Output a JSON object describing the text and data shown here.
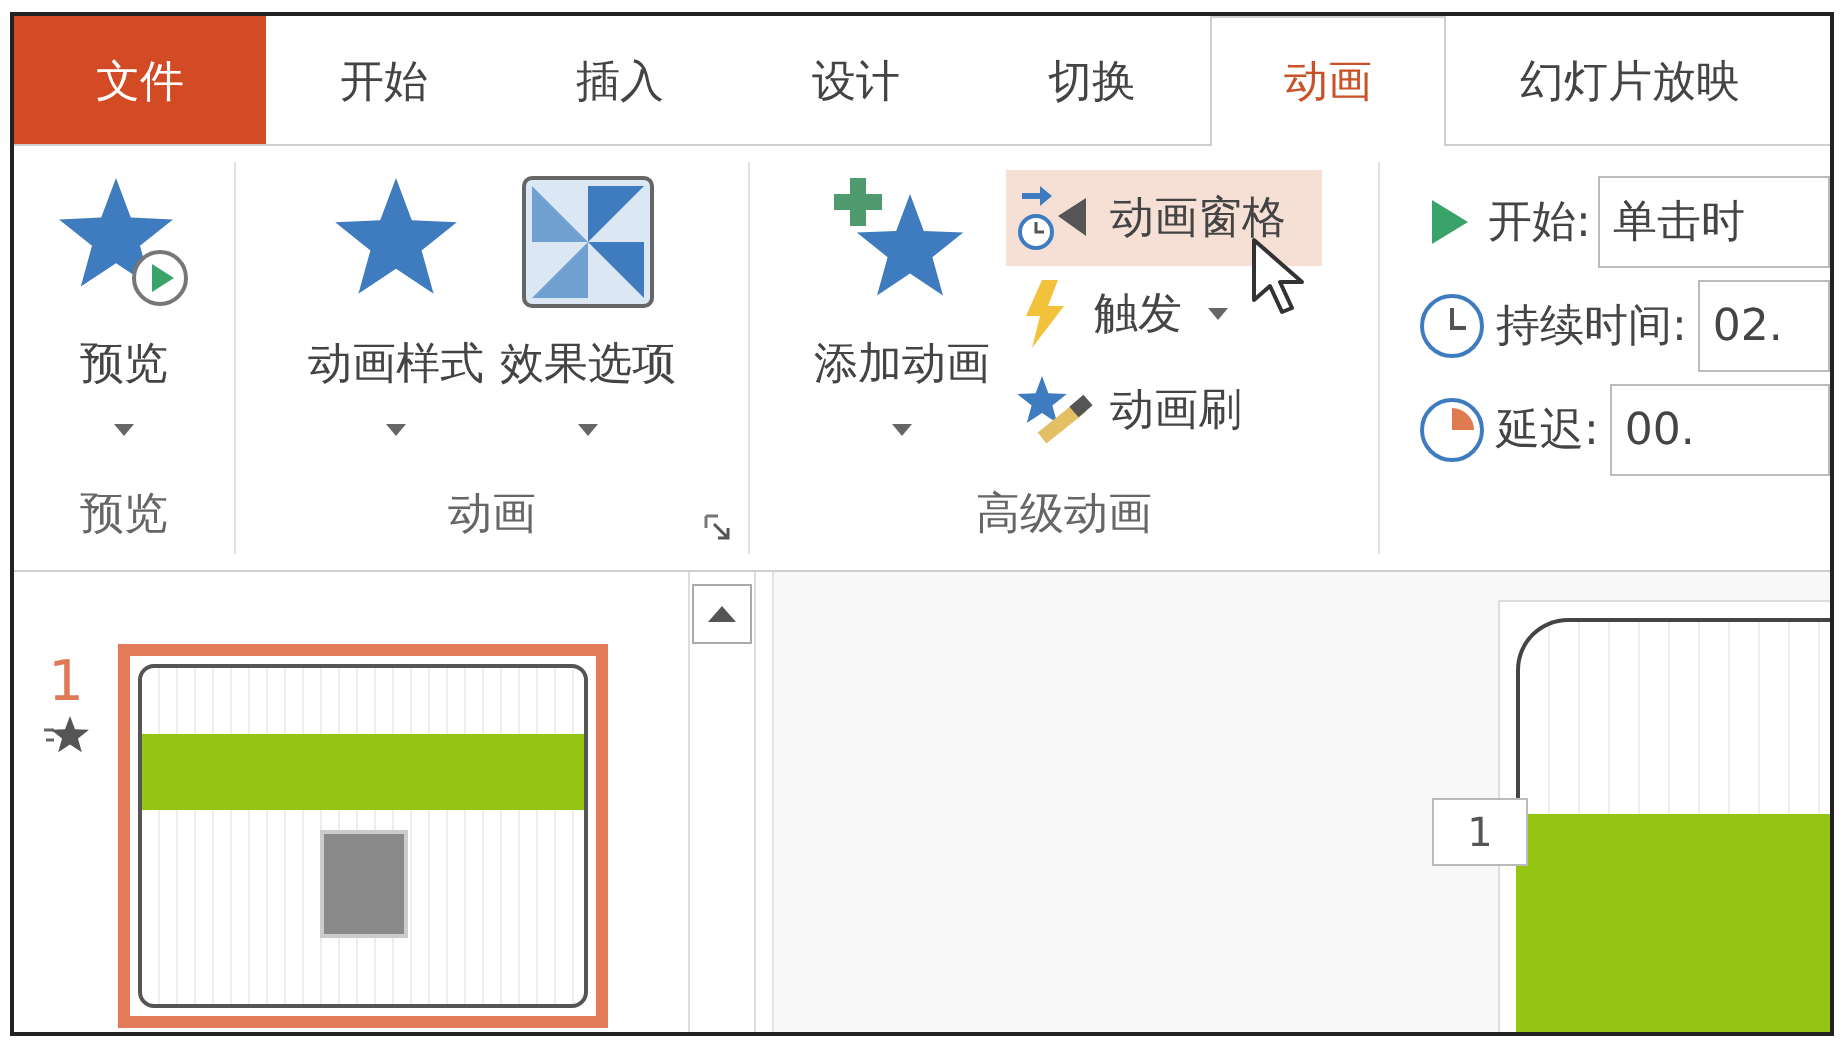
{
  "tabs": [
    {
      "label": "文件",
      "kind": "file",
      "selected": false
    },
    {
      "label": "开始",
      "kind": "tab",
      "selected": false
    },
    {
      "label": "插入",
      "kind": "tab",
      "selected": false
    },
    {
      "label": "设计",
      "kind": "tab",
      "selected": false
    },
    {
      "label": "切换",
      "kind": "tab",
      "selected": false
    },
    {
      "label": "动画",
      "kind": "tab",
      "selected": true
    },
    {
      "label": "幻灯片放映",
      "kind": "tab",
      "selected": false
    }
  ],
  "ribbon": {
    "groups": [
      {
        "label": "预览",
        "large_buttons": [
          {
            "label": "预览",
            "kind": "preview",
            "dropdown": true
          }
        ]
      },
      {
        "label": "动画",
        "launcher": true,
        "large_buttons": [
          {
            "label": "动画样式",
            "kind": "star",
            "dropdown": true
          },
          {
            "label": "效果选项",
            "kind": "effect",
            "dropdown": true
          }
        ]
      },
      {
        "label": "高级动画",
        "large_buttons": [
          {
            "label": "添加动画",
            "kind": "add",
            "dropdown": true
          }
        ],
        "small_buttons": [
          {
            "label": "动画窗格",
            "kind": "pane",
            "dropdown": false,
            "hovered": true
          },
          {
            "label": "触发",
            "kind": "bolt",
            "dropdown": true,
            "hovered": false
          },
          {
            "label": "动画刷",
            "kind": "brush",
            "dropdown": false,
            "hovered": false
          }
        ]
      },
      {
        "timing_rows": [
          {
            "kind": "play",
            "label": "开始:",
            "value": "单击时"
          },
          {
            "kind": "clock",
            "label": "持续时间:",
            "value": "02."
          },
          {
            "kind": "delay",
            "label": "延迟:",
            "value": "00."
          }
        ]
      }
    ]
  },
  "slides": [
    {
      "number": "1",
      "animated": true,
      "selected": true
    }
  ],
  "editor": {
    "animation_tag": "1"
  }
}
